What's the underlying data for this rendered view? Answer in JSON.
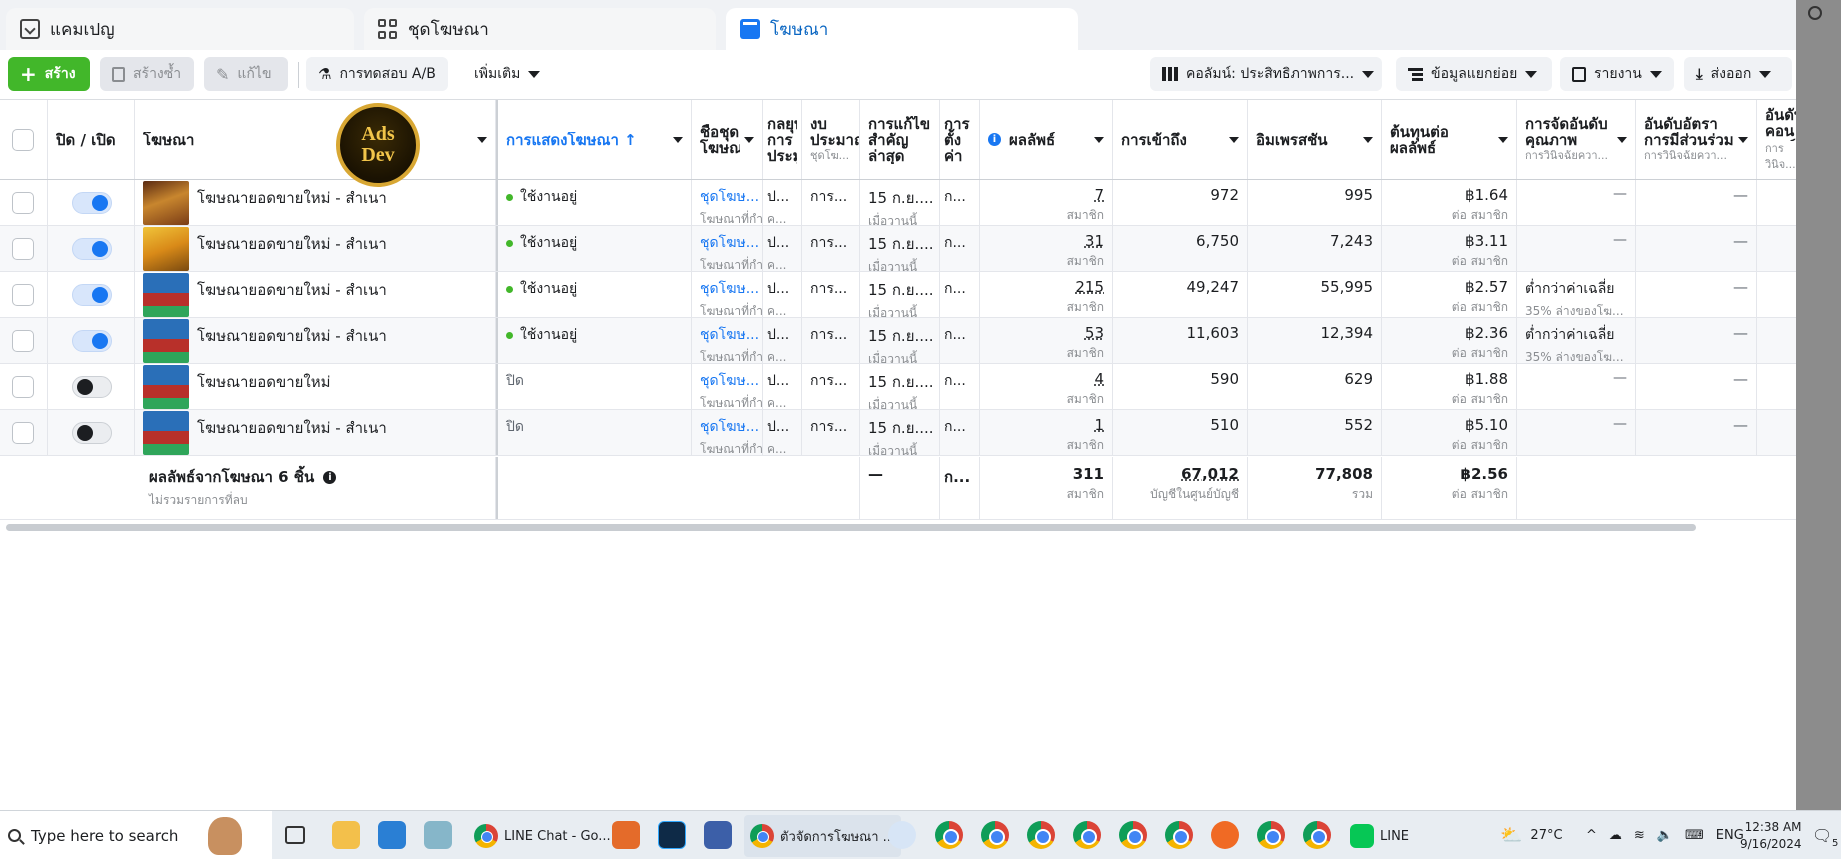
{
  "tabs": [
    {
      "label": "แคมเปญ",
      "icon": "folder-icon"
    },
    {
      "label": "ชุดโฆษณา",
      "icon": "grid-icon"
    },
    {
      "label": "โฆษณา",
      "icon": "ad-icon"
    }
  ],
  "toolbar": {
    "create": "สร้าง",
    "duplicate": "สร้างซ้ำ",
    "edit": "แก้ไข",
    "ab_test": "การทดสอบ A/B",
    "more": "เพิ่มเติม",
    "columns": "คอลัมน์: ประสิทธิภาพการ...",
    "breakdown": "ข้อมูลแยกย่อย",
    "reports": "รายงาน",
    "export": "ส่งออก"
  },
  "logo": {
    "line1": "Ads",
    "line2": "Dev"
  },
  "headers": {
    "toggle": "ปิด / เปิด",
    "ad": "โฆษณา",
    "delivery": "การแสดงโฆษณา ↑",
    "adset": "ชื่อชุดโฆษณา",
    "bid": "กลยุทธ์การประมูล",
    "budget": "งบประมาณ",
    "budget_sub": "ชุดโฆ...",
    "last_edit": "การแก้ไขสำคัญล่าสุด",
    "attribution": "การตั้งค่า",
    "results": "ผลลัพธ์",
    "reach": "การเข้าถึง",
    "impressions": "อิมเพรสชั่น",
    "cost": "ต้นทุนต่อผลลัพธ์",
    "quality": "การจัดอันดับคุณภาพ",
    "quality_sub": "การวินิจฉัยควา...",
    "engagement": "อันดับอัตราการมีส่วนร่วม",
    "engagement_sub": "การวินิจฉัยควา...",
    "conversion": "อันดับคอนเวอร์ชัน",
    "conversion_sub": "การวินิจ..."
  },
  "rows": [
    {
      "name": "โฆษณายอดขายใหม่ - สำเนา",
      "on": true,
      "status": "ใช้งานอยู่",
      "adset": "ชุดโฆษ...",
      "adset_sub": "โฆษณาที่กำ",
      "bid": "ป...",
      "bid_sub": "ค...",
      "budget": "การ...",
      "edit": "15 ก.ย....",
      "edit_sub": "เมื่อวานนี้",
      "attr": "ก...",
      "results": "7",
      "results_sub": "สมาชิก",
      "reach": "972",
      "impressions": "995",
      "cost": "฿1.64",
      "cost_sub": "ต่อ สมาชิก",
      "quality": "—",
      "quality_sub": "",
      "engagement": "—"
    },
    {
      "name": "โฆษณายอดขายใหม่ - สำเนา",
      "on": true,
      "status": "ใช้งานอยู่",
      "adset": "ชุดโฆษ...",
      "adset_sub": "โฆษณาที่กำ",
      "bid": "ป...",
      "bid_sub": "ค...",
      "budget": "การ...",
      "edit": "15 ก.ย....",
      "edit_sub": "เมื่อวานนี้",
      "attr": "ก...",
      "results": "31",
      "results_sub": "สมาชิก",
      "reach": "6,750",
      "impressions": "7,243",
      "cost": "฿3.11",
      "cost_sub": "ต่อ สมาชิก",
      "quality": "—",
      "quality_sub": "",
      "engagement": "—"
    },
    {
      "name": "โฆษณายอดขายใหม่ - สำเนา",
      "on": true,
      "status": "ใช้งานอยู่",
      "adset": "ชุดโฆษ...",
      "adset_sub": "โฆษณาที่กำ",
      "bid": "ป...",
      "bid_sub": "ค...",
      "budget": "การ...",
      "edit": "15 ก.ย....",
      "edit_sub": "เมื่อวานนี้",
      "attr": "ก...",
      "results": "215",
      "results_sub": "สมาชิก",
      "reach": "49,247",
      "impressions": "55,995",
      "cost": "฿2.57",
      "cost_sub": "ต่อ สมาชิก",
      "quality": "ต่ำกว่าค่าเฉลี่ย",
      "quality_sub": "35% ล่างของโฆ...",
      "engagement": "—"
    },
    {
      "name": "โฆษณายอดขายใหม่ - สำเนา",
      "on": true,
      "status": "ใช้งานอยู่",
      "adset": "ชุดโฆษ...",
      "adset_sub": "โฆษณาที่กำ",
      "bid": "ป...",
      "bid_sub": "ค...",
      "budget": "การ...",
      "edit": "15 ก.ย....",
      "edit_sub": "เมื่อวานนี้",
      "attr": "ก...",
      "results": "53",
      "results_sub": "สมาชิก",
      "reach": "11,603",
      "impressions": "12,394",
      "cost": "฿2.36",
      "cost_sub": "ต่อ สมาชิก",
      "quality": "ต่ำกว่าค่าเฉลี่ย",
      "quality_sub": "35% ล่างของโฆ...",
      "engagement": "—"
    },
    {
      "name": "โฆษณายอดขายใหม่",
      "on": false,
      "status": "ปิด",
      "adset": "ชุดโฆษ...",
      "adset_sub": "โฆษณาที่กำ",
      "bid": "ป...",
      "bid_sub": "ค...",
      "budget": "การ...",
      "edit": "15 ก.ย....",
      "edit_sub": "เมื่อวานนี้",
      "attr": "ก...",
      "results": "4",
      "results_sub": "สมาชิก",
      "reach": "590",
      "impressions": "629",
      "cost": "฿1.88",
      "cost_sub": "ต่อ สมาชิก",
      "quality": "—",
      "quality_sub": "",
      "engagement": "—"
    },
    {
      "name": "โฆษณายอดขายใหม่ - สำเนา",
      "on": false,
      "status": "ปิด",
      "adset": "ชุดโฆษ...",
      "adset_sub": "โฆษณาที่กำ",
      "bid": "ป...",
      "bid_sub": "ค...",
      "budget": "การ...",
      "edit": "15 ก.ย....",
      "edit_sub": "เมื่อวานนี้",
      "attr": "ก...",
      "results": "1",
      "results_sub": "สมาชิก",
      "reach": "510",
      "impressions": "552",
      "cost": "฿5.10",
      "cost_sub": "ต่อ สมาชิก",
      "quality": "—",
      "quality_sub": "",
      "engagement": "—"
    }
  ],
  "totals": {
    "label": "ผลลัพธ์จากโฆษณา 6 ชิ้น",
    "sub": "ไม่รวมรายการที่ลบ",
    "edit": "—",
    "attr": "ก...",
    "results": "311",
    "results_sub": "สมาชิก",
    "reach": "67,012",
    "reach_sub": "บัญชีในศูนย์บัญชี",
    "impressions": "77,808",
    "impressions_sub": "รวม",
    "cost": "฿2.56",
    "cost_sub": "ต่อ สมาชิก"
  },
  "taskbar": {
    "search_placeholder": "Type here to search",
    "line_chat": "LINE Chat - Go...",
    "ads_manager": "ตัวจัดการโฆษณา ...",
    "line": "LINE",
    "weather": "27°C",
    "lang": "ENG",
    "time": "12:38 AM",
    "date": "9/16/2024",
    "notifications": "5"
  },
  "colors": {
    "accent": "#1877f2",
    "create_green": "#42b72a",
    "active_dot": "#42b72a"
  }
}
